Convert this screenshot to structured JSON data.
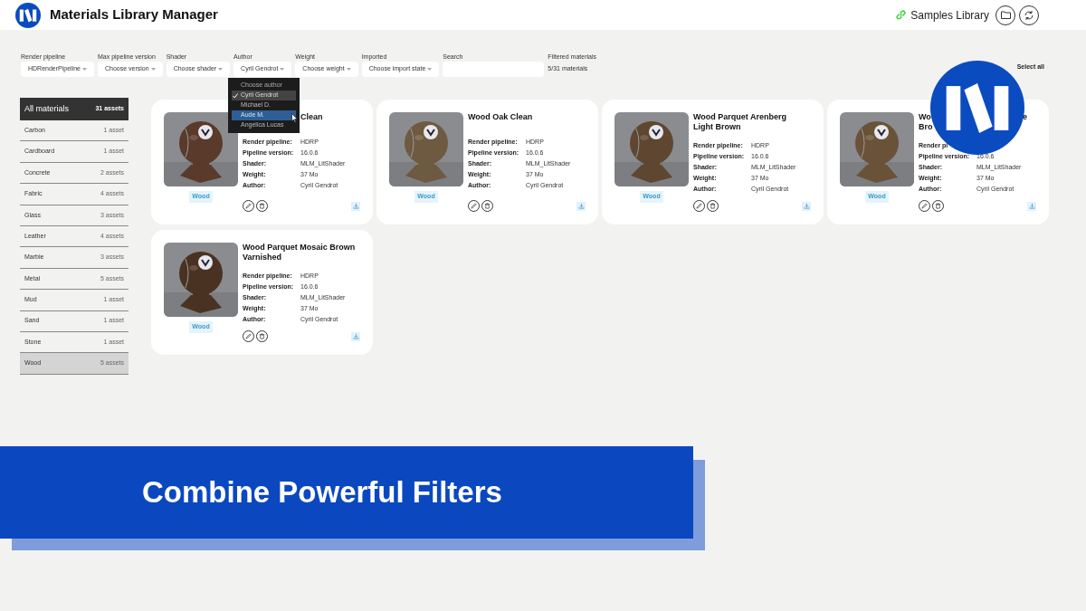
{
  "header": {
    "title": "Materials Library Manager",
    "library": "Samples Library"
  },
  "filters": [
    {
      "kind": "select",
      "label": "Render pipeline",
      "value": "HDRenderPipeline"
    },
    {
      "kind": "select",
      "label": "Max pipeline version",
      "value": "Choose version"
    },
    {
      "kind": "select",
      "label": "Shader",
      "value": "Choose shader"
    },
    {
      "kind": "select",
      "label": "Author",
      "value": "Cyril Gendrot"
    },
    {
      "kind": "select",
      "label": "Weight",
      "value": "Choose weight"
    },
    {
      "kind": "select",
      "label": "Imported",
      "value": "Choose import state"
    },
    {
      "kind": "search",
      "label": "Search"
    }
  ],
  "filtered": {
    "label": "Filtered materials",
    "value": "5/31 materials"
  },
  "selection_actions": [
    "Select all"
  ],
  "author_menu": {
    "prompt": "Choose author",
    "options": [
      {
        "label": "Cyril Gendrot",
        "selected": true,
        "hovered": false
      },
      {
        "label": "Michael D.",
        "selected": false,
        "hovered": false
      },
      {
        "label": "Aude M.",
        "selected": false,
        "hovered": true
      },
      {
        "label": "Angelica Lucas",
        "selected": false,
        "hovered": false
      }
    ]
  },
  "sidebar": {
    "header": {
      "label": "All materials",
      "count": "31 assets"
    },
    "items": [
      {
        "name": "Carbon",
        "count": "1 asset",
        "selected": false
      },
      {
        "name": "Cardboard",
        "count": "1 asset",
        "selected": false
      },
      {
        "name": "Concrete",
        "count": "2 assets",
        "selected": false
      },
      {
        "name": "Fabric",
        "count": "4 assets",
        "selected": false
      },
      {
        "name": "Glass",
        "count": "3 assets",
        "selected": false
      },
      {
        "name": "Leather",
        "count": "4 assets",
        "selected": false
      },
      {
        "name": "Marble",
        "count": "3 assets",
        "selected": false
      },
      {
        "name": "Metal",
        "count": "5 assets",
        "selected": false
      },
      {
        "name": "Mud",
        "count": "1 asset",
        "selected": false
      },
      {
        "name": "Sand",
        "count": "1 asset",
        "selected": false
      },
      {
        "name": "Stone",
        "count": "1 asset",
        "selected": false
      },
      {
        "name": "Wood",
        "count": "5 assets",
        "selected": true
      }
    ]
  },
  "cards": [
    {
      "title_lines": [
        [
          "Clean"
        ]
      ],
      "under_menu": true,
      "tag": "Wood",
      "fields": [
        {
          "label": "Render pipeline:",
          "value": "HDRP"
        },
        {
          "label": "Pipeline version:",
          "value": "16.0.6"
        },
        {
          "label": "Shader:",
          "value": "MLM_LitShader"
        },
        {
          "label": "Weight:",
          "value": "37 Mo"
        },
        {
          "label": "Author:",
          "value": "Cyril Gendrot"
        }
      ]
    },
    {
      "title_lines": [
        [
          "Wood Oak Clean"
        ]
      ],
      "under_menu": false,
      "tag": "Wood",
      "fields": [
        {
          "label": "Render pipeline:",
          "value": "HDRP"
        },
        {
          "label": "Pipeline version:",
          "value": "16.0.6"
        },
        {
          "label": "Shader:",
          "value": "MLM_LitShader"
        },
        {
          "label": "Weight:",
          "value": "37 Mo"
        },
        {
          "label": "Author:",
          "value": "Cyril Gendrot"
        }
      ]
    },
    {
      "title_lines": [
        [
          "Wood Parquet Arenberg"
        ],
        [
          "Light Brown"
        ]
      ],
      "under_menu": false,
      "tag": "Wood",
      "fields": [
        {
          "label": "Render pipeline:",
          "value": "HDRP"
        },
        {
          "label": "Pipeline version:",
          "value": "16.0.6"
        },
        {
          "label": "Shader:",
          "value": "MLM_LitShader"
        },
        {
          "label": "Weight:",
          "value": "37 Mo"
        },
        {
          "label": "Author:",
          "value": "Cyril Gendrot"
        }
      ]
    },
    {
      "title_lines": [
        [
          "Wo",
          "e"
        ],
        [
          "Bro"
        ]
      ],
      "under_menu": false,
      "tag": "Wood",
      "fields": [
        {
          "label": "Render pi"
        },
        {
          "label": "Pipeline version:",
          "value": "16.0.6"
        },
        {
          "label": "Shader:",
          "value": "MLM_LitShader"
        },
        {
          "label": "Weight:",
          "value": "37 Mo"
        },
        {
          "label": "Author:",
          "value": "Cyril Gendrot"
        }
      ]
    },
    {
      "title_lines": [
        [
          "Wood Parquet Mosaic Brown"
        ],
        [
          "Varnished"
        ]
      ],
      "under_menu": false,
      "tag": "Wood",
      "fields": [
        {
          "label": "Render pipeline:",
          "value": "HDRP"
        },
        {
          "label": "Pipeline version:",
          "value": "16.0.6"
        },
        {
          "label": "Shader:",
          "value": "MLM_LitShader"
        },
        {
          "label": "Weight:",
          "value": "37 Mo"
        },
        {
          "label": "Author:",
          "value": "Cyril Gendrot"
        }
      ]
    }
  ],
  "banner": {
    "text": "Combine Powerful Filters"
  }
}
